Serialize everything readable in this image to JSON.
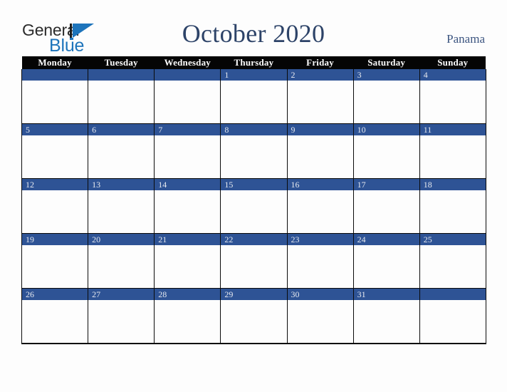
{
  "logo": {
    "word_primary": "General",
    "word_secondary": "Blue",
    "triangle_icon": "triangle-icon",
    "primary_color": "#2b2b2b",
    "secondary_color": "#1d74bb"
  },
  "header": {
    "title": "October 2020",
    "month": "October",
    "year": "2020",
    "country": "Panama",
    "title_color": "#2d4368",
    "country_color": "#3c5580"
  },
  "calendar": {
    "header_background": "#050505",
    "daynum_background": "#2e5395",
    "daynum_color": "#e6e9ef",
    "cell_background": "#fdfdfd",
    "border_color": "#0a0a0a",
    "weekday_headers": [
      "Monday",
      "Tuesday",
      "Wednesday",
      "Thursday",
      "Friday",
      "Saturday",
      "Sunday"
    ],
    "weeks": [
      [
        "",
        "",
        "",
        "1",
        "2",
        "3",
        "4"
      ],
      [
        "5",
        "6",
        "7",
        "8",
        "9",
        "10",
        "11"
      ],
      [
        "12",
        "13",
        "14",
        "15",
        "16",
        "17",
        "18"
      ],
      [
        "19",
        "20",
        "21",
        "22",
        "23",
        "24",
        "25"
      ],
      [
        "26",
        "27",
        "28",
        "29",
        "30",
        "31",
        ""
      ]
    ]
  }
}
